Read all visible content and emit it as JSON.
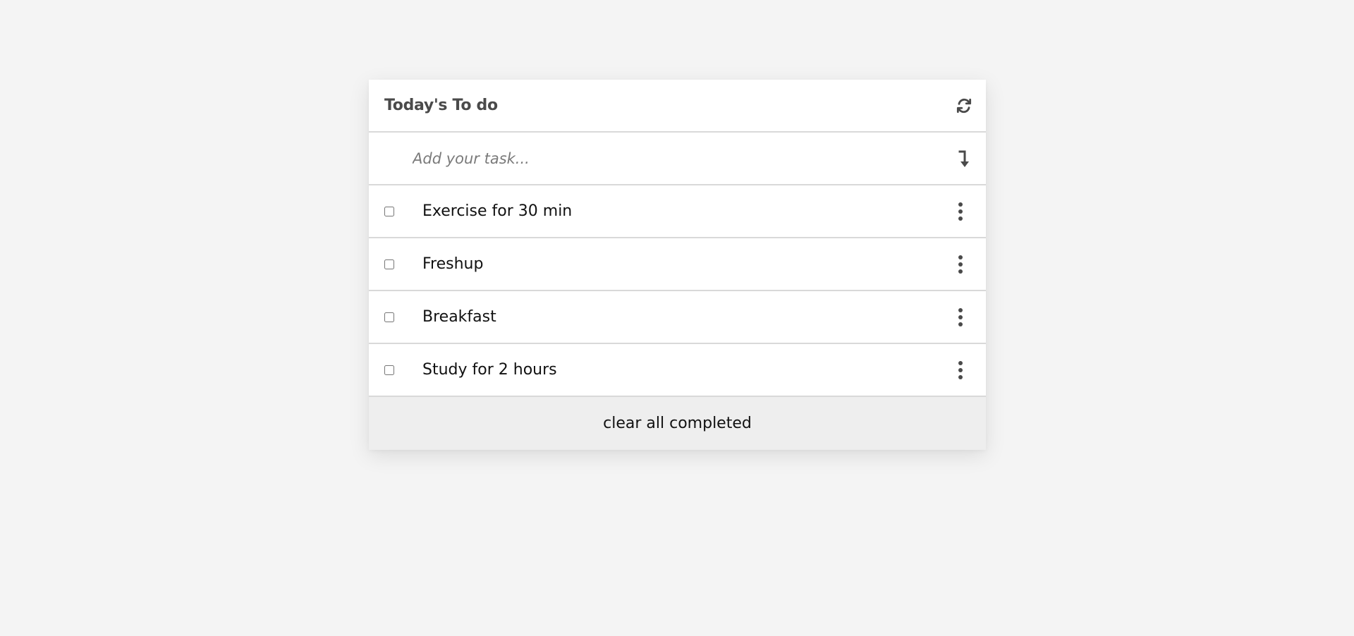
{
  "app": {
    "title": "Today's To do"
  },
  "header": {
    "refresh_icon": "refresh-icon"
  },
  "input": {
    "placeholder": "Add your task...",
    "value": "",
    "add_icon": "arrow-down-return-icon"
  },
  "tasks": [
    {
      "label": "Exercise for 30 min",
      "checked": false
    },
    {
      "label": "Freshup",
      "checked": false
    },
    {
      "label": "Breakfast",
      "checked": false
    },
    {
      "label": "Study for 2 hours",
      "checked": false
    }
  ],
  "footer": {
    "clear_label": "clear all completed"
  },
  "colors": {
    "background": "#f4f4f4",
    "card": "#ffffff",
    "divider": "#d9d9d9",
    "footer_bg": "#eeeeee",
    "icon": "#4a4a4a"
  }
}
